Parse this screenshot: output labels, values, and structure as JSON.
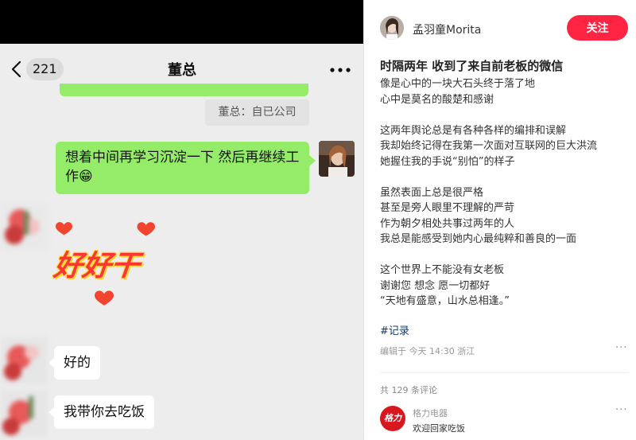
{
  "chat": {
    "unread_count": "221",
    "title": "董总",
    "quote": "董总：自已公司",
    "sent_message": "想着中间再学习沉淀一下 然后再继续工作😁",
    "sticker_text": "好好干",
    "received_1": "好的",
    "received_2": "我带你去吃饭"
  },
  "post": {
    "author_name": "孟羽童Morita",
    "follow_label": "关注",
    "title": "时隔两年 收到了来自前老板的微信",
    "paragraphs": [
      [
        "像是心中的一块大石头终于落了地",
        "心中是莫名的酸楚和感谢"
      ],
      [
        "这两年舆论总是有各种各样的编排和误解",
        "我却始终记得在我第一次面对互联网的巨大洪流",
        "她握住我的手说“别怕”的样子"
      ],
      [
        "虽然表面上总是很严格",
        "甚至是旁人眼里不理解的严苛",
        "作为朝夕相处共事过两年的人",
        "我总是能感受到她内心最纯粹和善良的一面"
      ],
      [
        "这个世界上不能没有女老板",
        "谢谢您 想念 愿一切都好",
        "“天地有盛意，山水总相逢。”"
      ]
    ],
    "hashtag": "#记录",
    "meta": "编辑于 今天 14:30 浙江",
    "comment_count": "共 129 条评论",
    "commenter_name": "格力电器",
    "commenter_logo": "格力",
    "comment_text": "欢迎回家吃饭"
  },
  "colors": {
    "chat_bg": "#ededed",
    "sent_bubble": "#95ec69",
    "follow_button": "#ff2442",
    "hashtag": "#13386c"
  },
  "icons": [
    "back-icon",
    "more-icon",
    "heart-icon",
    "ellipsis-icon"
  ]
}
